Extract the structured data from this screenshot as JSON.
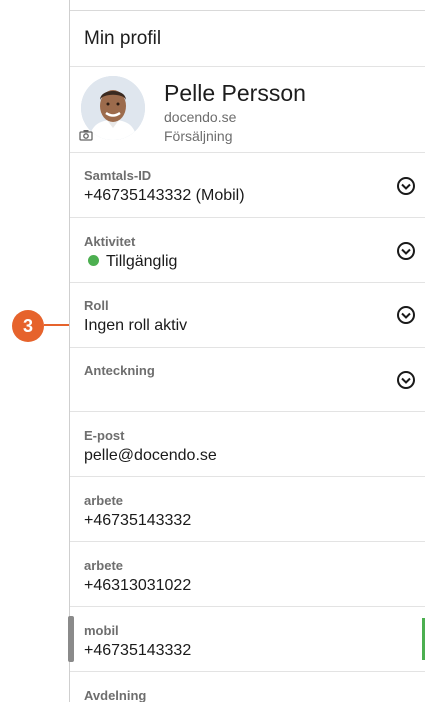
{
  "header": {
    "title": "Min profil"
  },
  "profile": {
    "name": "Pelle Persson",
    "domain": "docendo.se",
    "department": "Försäljning",
    "avatar_icon": "person-photo",
    "camera_icon": "camera-icon"
  },
  "fields": [
    {
      "label": "Samtals-ID",
      "value": "+46735143332 (Mobil)",
      "expandable": true
    },
    {
      "label": "Aktivitet",
      "value": "Tillgänglig",
      "status_color": "#4caf50",
      "expandable": true
    },
    {
      "label": "Roll",
      "value": "Ingen roll aktiv",
      "expandable": true
    },
    {
      "label": "Anteckning",
      "value": "",
      "expandable": true
    },
    {
      "label": "E-post",
      "value": "pelle@docendo.se"
    },
    {
      "label": "arbete",
      "value": "+46735143332"
    },
    {
      "label": "arbete",
      "value": "+46313031022"
    },
    {
      "label": "mobil",
      "value": "+46735143332"
    },
    {
      "label": "Avdelning",
      "value": ""
    }
  ],
  "annotation": {
    "number": "3",
    "color": "#e6632c"
  }
}
